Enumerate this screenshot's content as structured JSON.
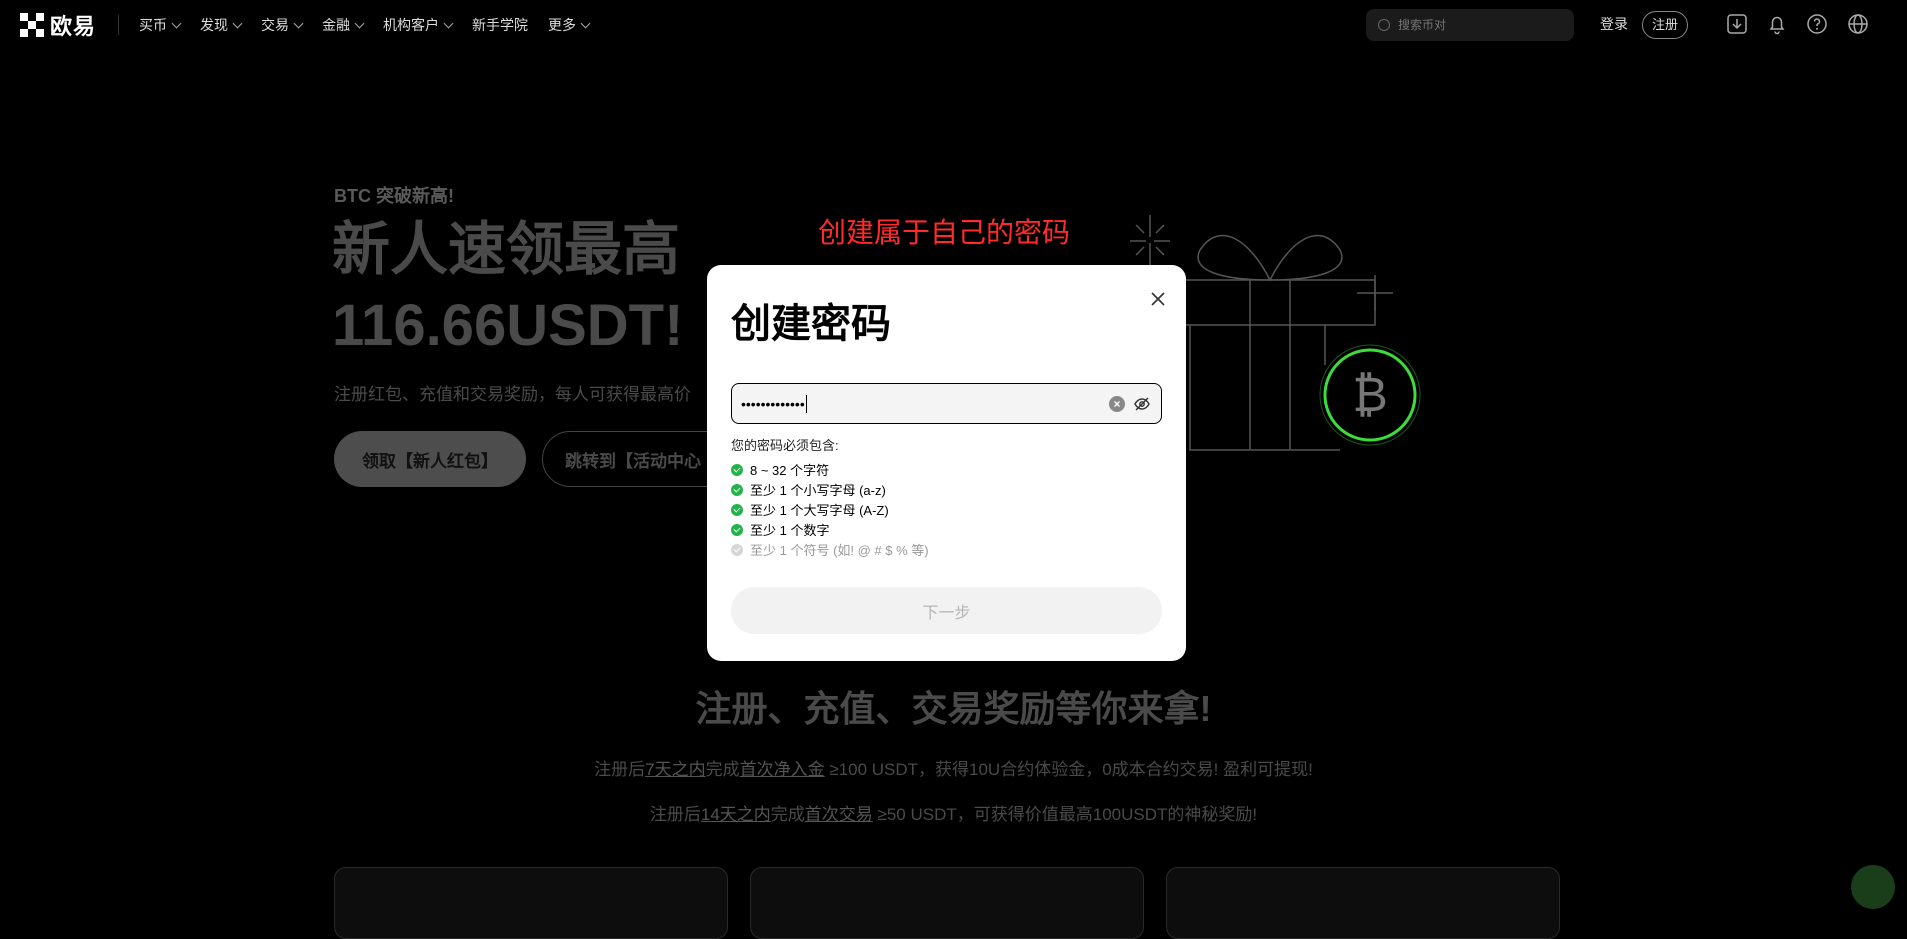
{
  "nav": {
    "logo_text": "欧易",
    "items": [
      "买币",
      "发现",
      "交易",
      "金融",
      "机构客户",
      "新手学院",
      "更多"
    ],
    "search_placeholder": "搜索币对",
    "login": "登录",
    "register": "注册"
  },
  "hero": {
    "kicker": "BTC 突破新高!",
    "title": "新人速领最高 116.66USDT!",
    "subtitle": "注册红包、充值和交易奖励，每人可获得最高价",
    "btn_primary": "领取【新人红包】",
    "btn_secondary": "跳转到【活动中心"
  },
  "section": {
    "title": "注册、充值、交易奖励等你来拿!",
    "line1": {
      "pre": "注册后",
      "u1": "7天之内",
      "mid": "完成",
      "u2": "首次净入金",
      "post": " ≥100 USDT，获得10U合约体验金，0成本合约交易! 盈利可提现!"
    },
    "line2": {
      "pre": "注册后",
      "u1": "14天之内",
      "mid": "完成",
      "u2": "首次交易",
      "post": " ≥50 USDT，可获得价值最高100USDT的神秘奖励!"
    }
  },
  "annotation": "创建属于自己的密码",
  "modal": {
    "title": "创建密码",
    "password_value": "•••••••••••••",
    "rules_heading": "您的密码必须包含:",
    "rules": [
      {
        "text": "8 ~ 32 个字符",
        "met": true
      },
      {
        "text": "至少 1 个小写字母 (a-z)",
        "met": true
      },
      {
        "text": "至少 1 个大写字母 (A-Z)",
        "met": true
      },
      {
        "text": "至少 1 个数字",
        "met": true
      },
      {
        "text": "至少 1 个符号 (如! @ # $ % 等)",
        "met": false
      }
    ],
    "next_button": "下一步"
  },
  "colors": {
    "check_green": "#22b34a",
    "annotation_red": "#ff2a2a",
    "btc_glow": "#3ddc3d"
  }
}
